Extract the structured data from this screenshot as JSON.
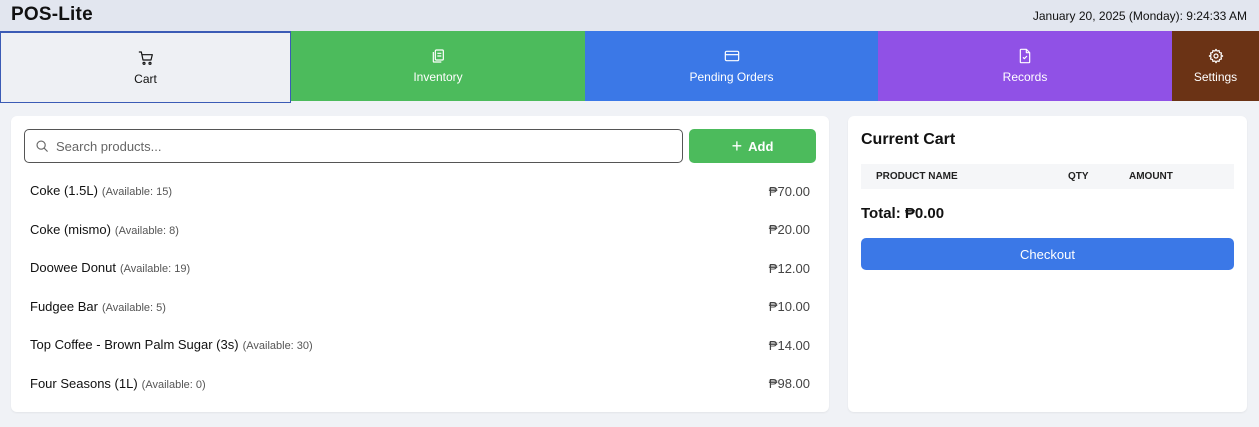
{
  "app": {
    "title": "POS-Lite",
    "datetime": "January 20, 2025 (Monday): 9:24:33 AM"
  },
  "tabs": [
    {
      "label": "Cart",
      "icon": "cart-icon",
      "color": "#eef0f4"
    },
    {
      "label": "Inventory",
      "icon": "inventory-icon",
      "color": "#4cbb5c"
    },
    {
      "label": "Pending Orders",
      "icon": "credit-card-icon",
      "color": "#3b78e7"
    },
    {
      "label": "Records",
      "icon": "document-icon",
      "color": "#9051e6"
    },
    {
      "label": "Settings",
      "icon": "gear-icon",
      "color": "#6b3315"
    }
  ],
  "search": {
    "placeholder": "Search products...",
    "value": ""
  },
  "add_button": {
    "label": "Add"
  },
  "products": [
    {
      "name": "Coke (1.5L)",
      "available": "(Available: 15)",
      "price": "₱70.00"
    },
    {
      "name": "Coke (mismo)",
      "available": "(Available: 8)",
      "price": "₱20.00"
    },
    {
      "name": "Doowee Donut",
      "available": "(Available: 19)",
      "price": "₱12.00"
    },
    {
      "name": "Fudgee Bar",
      "available": "(Available: 5)",
      "price": "₱10.00"
    },
    {
      "name": "Top Coffee - Brown Palm Sugar (3s)",
      "available": "(Available: 30)",
      "price": "₱14.00"
    },
    {
      "name": "Four Seasons (1L)",
      "available": "(Available: 0)",
      "price": "₱98.00"
    }
  ],
  "cart": {
    "title": "Current Cart",
    "columns": [
      "PRODUCT NAME",
      "QTY",
      "AMOUNT"
    ],
    "items": [],
    "total_label": "Total: ₱0.00",
    "checkout_label": "Checkout"
  },
  "colors": {
    "accent_green": "#4cbb5c",
    "accent_blue": "#3b78e7",
    "accent_purple": "#9051e6",
    "accent_brown": "#6b3315"
  }
}
